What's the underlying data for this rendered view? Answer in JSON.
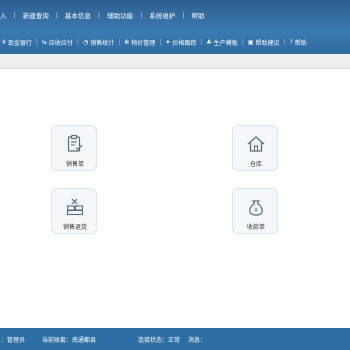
{
  "menubar": {
    "items": [
      {
        "label": "入"
      },
      {
        "label": "新建查询"
      },
      {
        "label": "基本信息"
      },
      {
        "label": "辅助功能"
      },
      {
        "label": "系统维护"
      },
      {
        "label": "帮助"
      }
    ]
  },
  "toolbar": {
    "buttons": [
      {
        "label": "现金银行",
        "icon": "currency-yen-icon"
      },
      {
        "label": "应收应付",
        "icon": "exchange-icon"
      },
      {
        "label": "销售统计",
        "icon": "chart-icon"
      },
      {
        "label": "物价管理",
        "icon": "gear-icon"
      },
      {
        "label": "价格跟踪",
        "icon": "tracking-icon"
      },
      {
        "label": "生产模板",
        "icon": "template-icon"
      },
      {
        "label": "帮助建议",
        "icon": "help-doc-icon"
      },
      {
        "label": "帮助",
        "icon": "help-icon"
      }
    ]
  },
  "main": {
    "tiles": [
      {
        "label": "销售单",
        "icon": "sales-order-icon"
      },
      {
        "label": "仓库",
        "icon": "warehouse-icon"
      },
      {
        "label": "销售退货",
        "icon": "sales-return-icon"
      },
      {
        "label": "收款单",
        "icon": "receipt-icon"
      }
    ]
  },
  "statusbar": {
    "user": "：管理员",
    "account": "当前账套：南通都县",
    "connection": "连接状态：正常",
    "message": "消息："
  },
  "colors": {
    "menubar": "#2d5f8f",
    "toolbar": "#3b7ab3",
    "statusbar": "#2d6ea5",
    "tile_background": "#f4f8fb",
    "icon_stroke": "#5d6d7a"
  }
}
